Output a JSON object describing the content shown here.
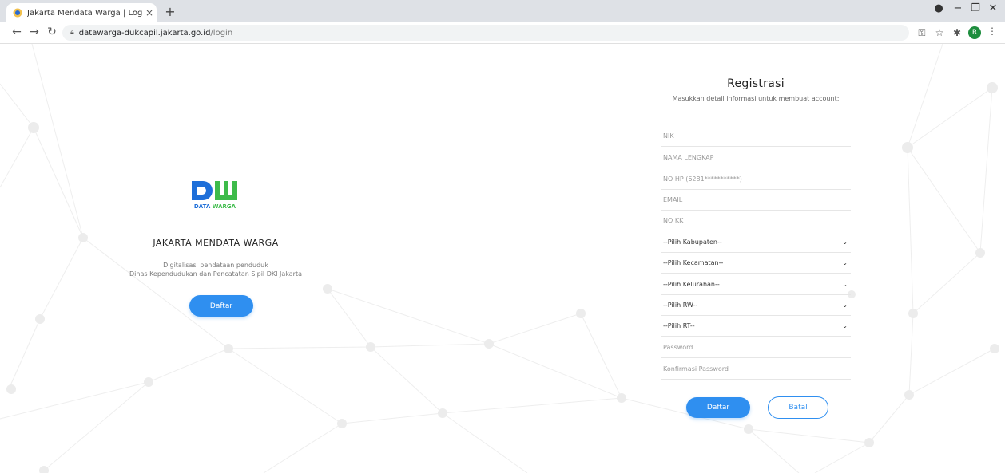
{
  "browser": {
    "tab_title": "Jakarta Mendata Warga | Login",
    "tab_close": "×",
    "new_tab": "+",
    "url_host": "datawarga-dukcapil.jakarta.go.id",
    "url_path": "/login",
    "profile_initial": "R"
  },
  "left": {
    "logo_text": "DATA WARGA",
    "title": "JAKARTA MENDATA WARGA",
    "subtitle_line1": "Digitalisasi pendataan penduduk",
    "subtitle_line2": "Dinas Kependudukan dan Pencatatan Sipil DKI Jakarta",
    "button": "Daftar"
  },
  "form": {
    "title": "Registrasi",
    "subtitle": "Masukkan detail informasi untuk membuat account:",
    "nik_placeholder": "NIK",
    "nama_placeholder": "NAMA LENGKAP",
    "hp_placeholder": "NO HP (6281***********)",
    "email_placeholder": "EMAIL",
    "kk_placeholder": "NO KK",
    "kabupaten": "--Pilih Kabupaten--",
    "kecamatan": "--Pilih Kecamatan--",
    "kelurahan": "--Pilih Kelurahan--",
    "rw": "--Pilih RW--",
    "rt": "--Pilih RT--",
    "password_placeholder": "Password",
    "confirm_placeholder": "Konfirmasi Password",
    "submit": "Daftar",
    "cancel": "Batal"
  },
  "colors": {
    "primary": "#2f8ff0",
    "logo_blue": "#1e6fd9",
    "logo_green": "#3dbb4a"
  }
}
